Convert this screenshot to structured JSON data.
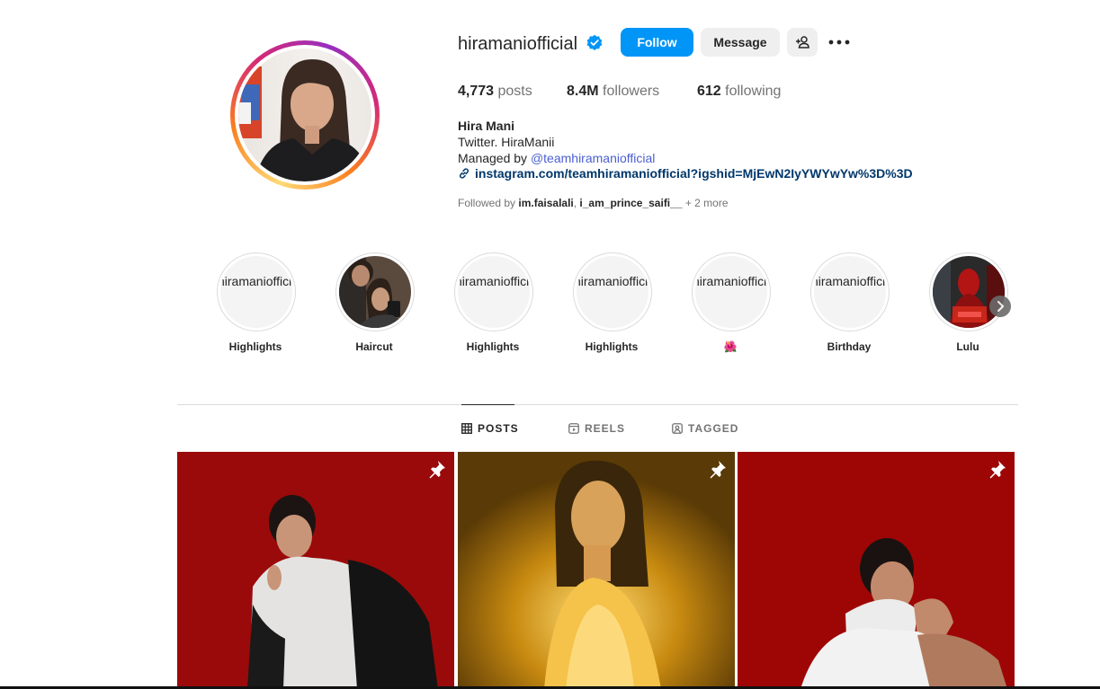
{
  "profile": {
    "username": "hiramaniofficial",
    "verified": true,
    "buttons": {
      "follow": "Follow",
      "message": "Message"
    },
    "stats": {
      "posts_count": "4,773",
      "posts_label": "posts",
      "followers_count": "8.4M",
      "followers_label": "followers",
      "following_count": "612",
      "following_label": "following"
    },
    "bio": {
      "name": "Hira Mani",
      "line1": "Twitter. HiraManii",
      "managed_prefix": "Managed by ",
      "managed_handle": "@teamhiramaniofficial",
      "link": "instagram.com/teamhiramaniofficial?igshid=MjEwN2IyYWYwYw%3D%3D"
    },
    "followed_by": {
      "prefix": "Followed by ",
      "user1": "im.faisalali",
      "sep": ", ",
      "user2": "i_am_prince_saifi__",
      "more": " + 2 more"
    }
  },
  "highlights": {
    "broken_alt": "hiramaniofficial's highlight story picture",
    "items": [
      {
        "label": "Highlights",
        "image": "broken"
      },
      {
        "label": "Haircut",
        "image": "photo"
      },
      {
        "label": "Highlights",
        "image": "broken"
      },
      {
        "label": "Highlights",
        "image": "broken"
      },
      {
        "label": "🌺",
        "image": "broken"
      },
      {
        "label": "Birthday",
        "image": "broken"
      },
      {
        "label": "Lulu",
        "image": "photo-red"
      }
    ]
  },
  "tabs": [
    {
      "label": "POSTS",
      "icon": "grid-icon",
      "active": true
    },
    {
      "label": "REELS",
      "icon": "reels-icon",
      "active": false
    },
    {
      "label": "TAGGED",
      "icon": "tagged-icon",
      "active": false
    }
  ],
  "posts": [
    {
      "pinned": true,
      "background": "#9a0a0a"
    },
    {
      "pinned": true,
      "background": "#8a5a08"
    },
    {
      "pinned": true,
      "background": "#9e0606"
    }
  ],
  "colors": {
    "accent": "#0095f6",
    "link": "#00376b",
    "mention": "#4a5fd1",
    "secondary_text": "#737373"
  }
}
